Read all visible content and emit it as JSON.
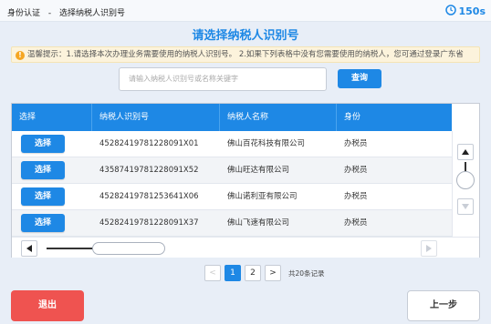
{
  "header": {
    "crumb_root": "身份认证",
    "crumb_sep": "-",
    "crumb_current": "选择纳税人识别号",
    "timer": "150s"
  },
  "title": "请选择纳税人识别号",
  "notice": "温馨提示：1.请选择本次办理业务需要使用的纳税人识别号。 2.如果下列表格中没有您需要使用的纳税人，您可通过登录广东省",
  "search": {
    "placeholder": "请输入纳税人识别号或名称关键字",
    "button": "查询"
  },
  "table": {
    "columns": [
      "选择",
      "纳税人识别号",
      "纳税人名称",
      "身份"
    ],
    "select_label": "选择",
    "rows": [
      {
        "id": "45282419781228091X01",
        "name": "佛山百花科技有限公司",
        "role": "办税员"
      },
      {
        "id": "43587419781228091X52",
        "name": "佛山旺达有限公司",
        "role": "办税员"
      },
      {
        "id": "45282419781253641X06",
        "name": "佛山诺利亚有限公司",
        "role": "办税员"
      },
      {
        "id": "45282419781228091X37",
        "name": "佛山飞速有限公司",
        "role": "办税员"
      }
    ]
  },
  "pager": {
    "prev": "<",
    "pages": [
      "1",
      "2"
    ],
    "next": ">",
    "total": "共20条记录"
  },
  "footer": {
    "exit": "退出",
    "prev_step": "上一步"
  },
  "colors": {
    "primary": "#1e88e5",
    "danger": "#ef5350",
    "notice_bg": "#fcf3dc"
  }
}
